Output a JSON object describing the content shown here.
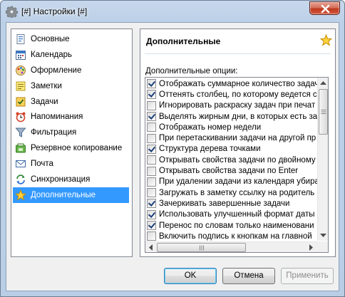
{
  "window": {
    "title": "[#] Настройки [#]",
    "accent_color": "#3399ff"
  },
  "sidebar": {
    "items": [
      {
        "label": "Основные",
        "icon": "settings-page-icon",
        "selected": false
      },
      {
        "label": "Календарь",
        "icon": "calendar-icon",
        "selected": false
      },
      {
        "label": "Оформление",
        "icon": "palette-icon",
        "selected": false
      },
      {
        "label": "Заметки",
        "icon": "notes-icon",
        "selected": false
      },
      {
        "label": "Задачи",
        "icon": "tasks-icon",
        "selected": false
      },
      {
        "label": "Напоминания",
        "icon": "alarm-clock-icon",
        "selected": false
      },
      {
        "label": "Фильтрация",
        "icon": "funnel-icon",
        "selected": false
      },
      {
        "label": "Резервное копирование",
        "icon": "backup-icon",
        "selected": false
      },
      {
        "label": "Почта",
        "icon": "mail-icon",
        "selected": false
      },
      {
        "label": "Синхронизация",
        "icon": "sync-icon",
        "selected": false
      },
      {
        "label": "Дополнительные",
        "icon": "star-icon",
        "selected": true
      }
    ]
  },
  "section": {
    "title": "Дополнительные",
    "options_label": "Дополнительные опции:",
    "options": [
      {
        "label": "Отображать суммарное количество задач",
        "checked": true
      },
      {
        "label": "Оттенять столбец, по которому ведется со",
        "checked": true
      },
      {
        "label": "Игнорировать раскраску задач при печат",
        "checked": false
      },
      {
        "label": "Выделять жирным дни, в которых есть зад",
        "checked": true
      },
      {
        "label": "Отображать номер недели",
        "checked": false
      },
      {
        "label": "При перетаскивании задачи на другой пр",
        "checked": false
      },
      {
        "label": "Структура дерева точками",
        "checked": true
      },
      {
        "label": "Открывать свойства задачи по двойному",
        "checked": false
      },
      {
        "label": "Открывать свойства задачи по Enter",
        "checked": false
      },
      {
        "label": "При удалении задачи из календаря убира",
        "checked": false
      },
      {
        "label": "Загружать в заметку ссылку на родитель",
        "checked": false
      },
      {
        "label": "Зачеркивать завершенные задачи",
        "checked": true
      },
      {
        "label": "Использовать улучшенный формат даты",
        "checked": true
      },
      {
        "label": "Перенос по словам только наименовани",
        "checked": true
      },
      {
        "label": "Включить подпись к кнопкам на главной",
        "checked": false
      }
    ]
  },
  "buttons": {
    "ok": "OK",
    "cancel": "Отмена",
    "apply": "Применить"
  }
}
